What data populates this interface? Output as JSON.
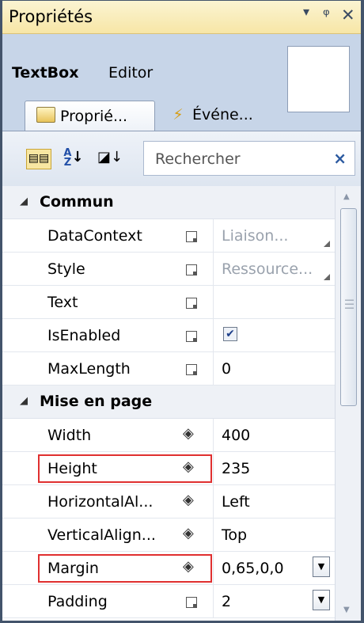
{
  "window": {
    "title": "Propriétés",
    "controls": {
      "dropdown": "▾",
      "pin": "฿",
      "close": "✕"
    }
  },
  "header": {
    "type_name": "TextBox",
    "editor_label": "Editor",
    "tabs": [
      {
        "label": "Proprié...",
        "icon": "properties-icon",
        "selected": true
      },
      {
        "label": "Événe...",
        "icon": "lightning-icon",
        "selected": false
      }
    ]
  },
  "toolbar": {
    "search_placeholder": "Rechercher",
    "search_clear": "×",
    "sort_categorized_icon": "categorized-icon",
    "sort_alpha_icon": "sort-alpha-icon",
    "page_icon": "property-pages-icon"
  },
  "grid": {
    "categories": [
      {
        "name": "Commun",
        "expanded": true,
        "properties": [
          {
            "name": "DataContext",
            "marker": "empty",
            "value": "Liaison...",
            "value_dim": true,
            "corner": true
          },
          {
            "name": "Style",
            "marker": "empty",
            "value": "Ressource...",
            "value_dim": true,
            "corner": true
          },
          {
            "name": "Text",
            "marker": "empty",
            "value": ""
          },
          {
            "name": "IsEnabled",
            "marker": "empty",
            "value": "",
            "checkbox": true,
            "checked": true
          },
          {
            "name": "MaxLength",
            "marker": "empty",
            "value": "0"
          }
        ]
      },
      {
        "name": "Mise en page",
        "expanded": true,
        "properties": [
          {
            "name": "Width",
            "marker": "set",
            "value": "400"
          },
          {
            "name": "Height",
            "marker": "set",
            "value": "235",
            "highlighted": true
          },
          {
            "name": "HorizontalAl...",
            "marker": "set",
            "value": "Left"
          },
          {
            "name": "VerticalAlign...",
            "marker": "set",
            "value": "Top"
          },
          {
            "name": "Margin",
            "marker": "set",
            "value": "0,65,0,0",
            "highlighted": true,
            "dropdown": true
          },
          {
            "name": "Padding",
            "marker": "empty",
            "value": "2",
            "dropdown": true
          }
        ]
      }
    ]
  },
  "colors": {
    "title_bar": "#f7e6a6",
    "panel_bg": "#c7d5e8",
    "highlight_box": "#e03030",
    "frame": "#43546b"
  }
}
